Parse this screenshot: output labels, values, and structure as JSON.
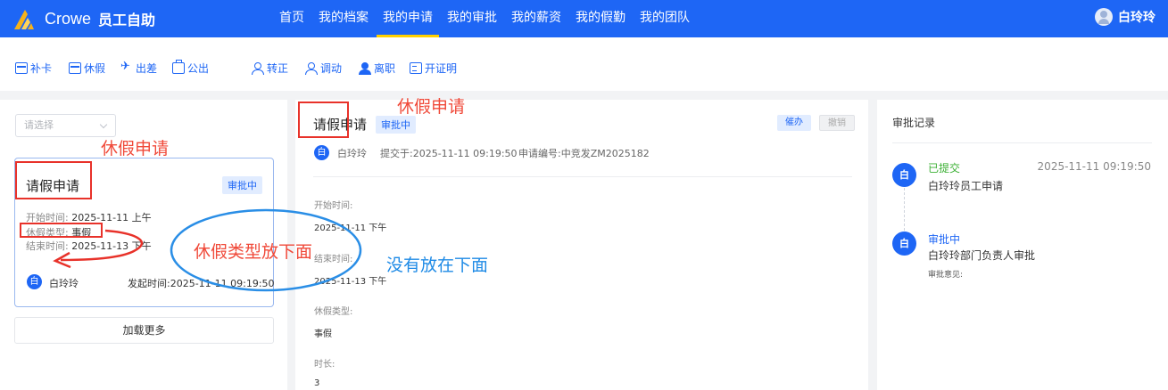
{
  "header": {
    "brand": "Crowe",
    "subtitle": "员工自助",
    "nav": [
      {
        "label": "首页"
      },
      {
        "label": "我的档案"
      },
      {
        "label": "我的申请",
        "active": true
      },
      {
        "label": "我的审批"
      },
      {
        "label": "我的薪资"
      },
      {
        "label": "我的假勤"
      },
      {
        "label": "我的团队"
      }
    ],
    "user": "白玲玲"
  },
  "toolbar": {
    "buka": "补卡",
    "xiujia": "休假",
    "chuchai": "出差",
    "gongchu": "公出",
    "zhuanzheng": "转正",
    "diaodong": "调动",
    "lizhi": "离职",
    "kaizhengming": "开证明"
  },
  "left": {
    "select_placeholder": "请选择",
    "card": {
      "title": "请假申请",
      "status": "审批中",
      "start_label": "开始时间:",
      "start_value": "2025-11-11 上午",
      "type_label": "休假类型:",
      "type_value": "事假",
      "end_label": "结束时间:",
      "end_value": "2025-11-13 下午",
      "avatar_char": "白",
      "user": "白玲玲",
      "submitted": "发起时间:2025-11-11 09:19:50"
    },
    "load_more": "加载更多"
  },
  "detail": {
    "title": "请假申请",
    "status": "审批中",
    "urge": "催办",
    "revoke": "撤销",
    "avatar_char": "白",
    "user": "白玲玲",
    "submitted": "提交于:2025-11-11 09:19:50",
    "apply_no": "申请编号:中竞发ZM2025182",
    "start_label": "开始时间:",
    "start_value": "2025-11-11 下午",
    "end_label": "结束时间:",
    "end_value": "2025-11-13 下午",
    "type_label": "休假类型:",
    "type_value": "事假",
    "duration_label": "时长:",
    "duration_value": "3"
  },
  "records": {
    "title": "审批记录",
    "items": [
      {
        "avatar": "白",
        "status": "已提交",
        "status_color": "#3cb035",
        "text": "白玲玲员工申请",
        "time": "2025-11-11 09:19:50"
      },
      {
        "avatar": "白",
        "status": "审批中",
        "status_color": "#1e66f5",
        "text": "白玲玲部门负责人审批",
        "note": "审批意见:"
      }
    ]
  },
  "annotations": {
    "top": "休假申请",
    "left": "休假申请",
    "middle": "休假类型放下面",
    "blue": "没有放在下面"
  }
}
